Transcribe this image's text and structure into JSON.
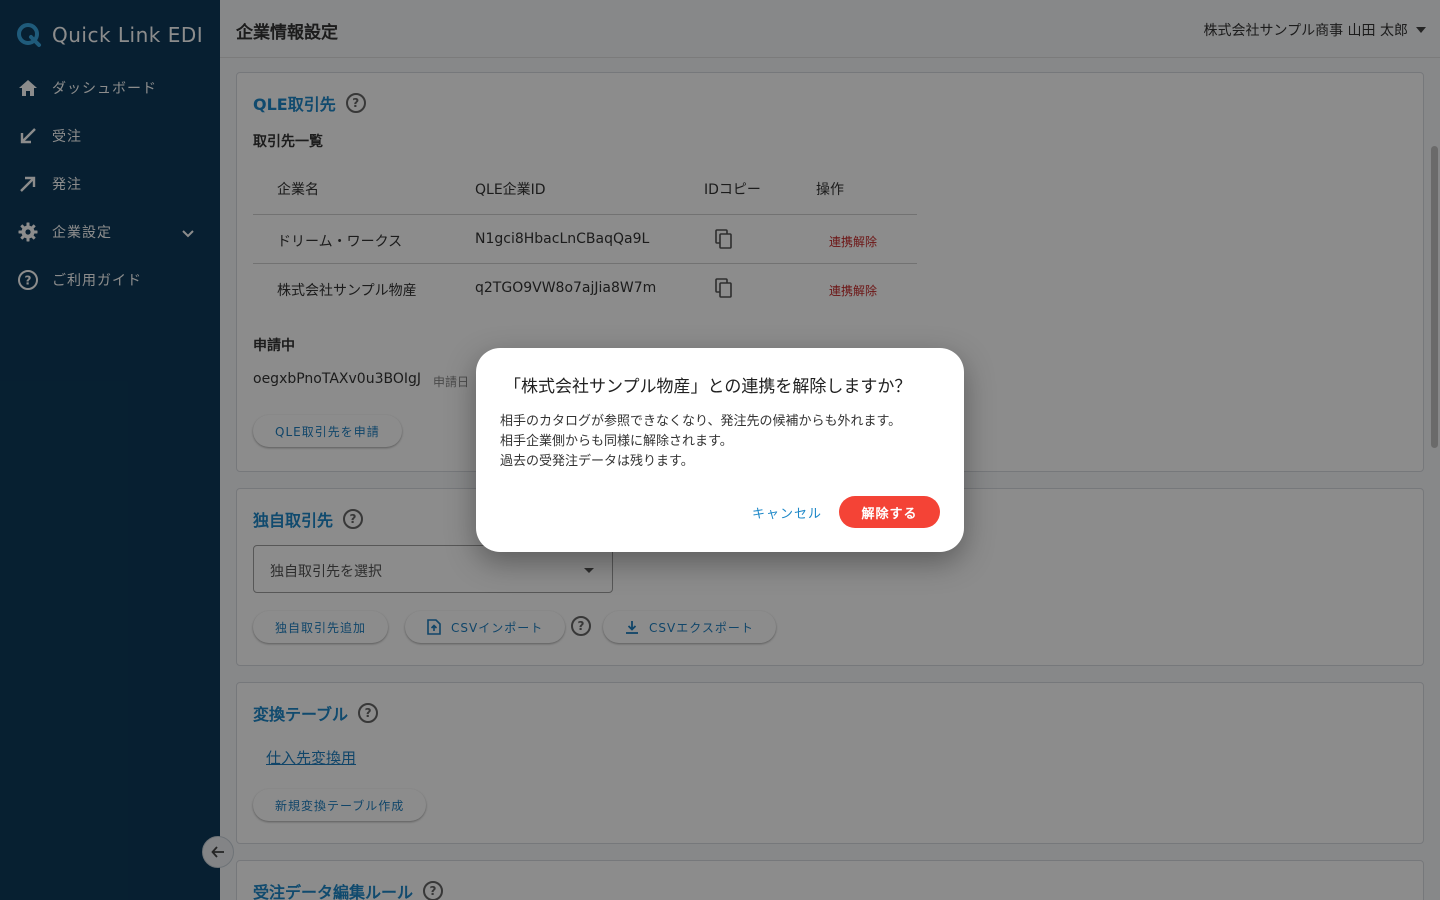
{
  "app": {
    "name": "Quick Link EDI"
  },
  "sidebar": {
    "items": [
      {
        "label": "ダッシュボード",
        "icon": "home-icon"
      },
      {
        "label": "受注",
        "icon": "arrow-down-left-icon"
      },
      {
        "label": "発注",
        "icon": "arrow-up-right-icon"
      },
      {
        "label": "企業設定",
        "icon": "gear-icon",
        "expandable": true
      },
      {
        "label": "ご利用ガイド",
        "icon": "help-circle-icon"
      }
    ]
  },
  "header": {
    "title": "企業情報設定",
    "user": "株式会社サンプル商事 山田 太郎"
  },
  "qle": {
    "title": "QLE取引先",
    "list_title": "取引先一覧",
    "columns": [
      "企業名",
      "QLE企業ID",
      "IDコピー",
      "操作"
    ],
    "rows": [
      {
        "company": "ドリーム・ワークス",
        "id": "N1gci8HbacLnCBaqQa9L",
        "action": "連携解除"
      },
      {
        "company": "株式会社サンプル物産",
        "id": "q2TGO9VW8o7ajJia8W7m",
        "action": "連携解除"
      }
    ],
    "pending_title": "申請中",
    "pending_id": "oegxbPnoTAXv0u3BOIgJ",
    "pending_date_label": "申請日",
    "apply_button": "QLE取引先を申請"
  },
  "own": {
    "title": "独自取引先",
    "select_placeholder": "独自取引先を選択",
    "add_button": "独自取引先追加",
    "import_button": "CSVインポート",
    "export_button": "CSVエクスポート"
  },
  "conv": {
    "title": "変換テーブル",
    "link": "仕入先変換用",
    "new_button": "新規変換テーブル作成"
  },
  "rules": {
    "title": "受注データ編集ルール"
  },
  "dialog": {
    "title": "「株式会社サンプル物産」との連携を解除しますか？",
    "line1": "相手のカタログが参照できなくなり、発注先の候補からも外れます。",
    "line2": "相手企業側からも同様に解除されます。",
    "line3": "過去の受発注データは残ります。",
    "cancel": "キャンセル",
    "confirm": "解除する"
  },
  "colors": {
    "sidebar": "#0d3a5a",
    "accent": "#1e88c8",
    "danger": "#f44336"
  }
}
